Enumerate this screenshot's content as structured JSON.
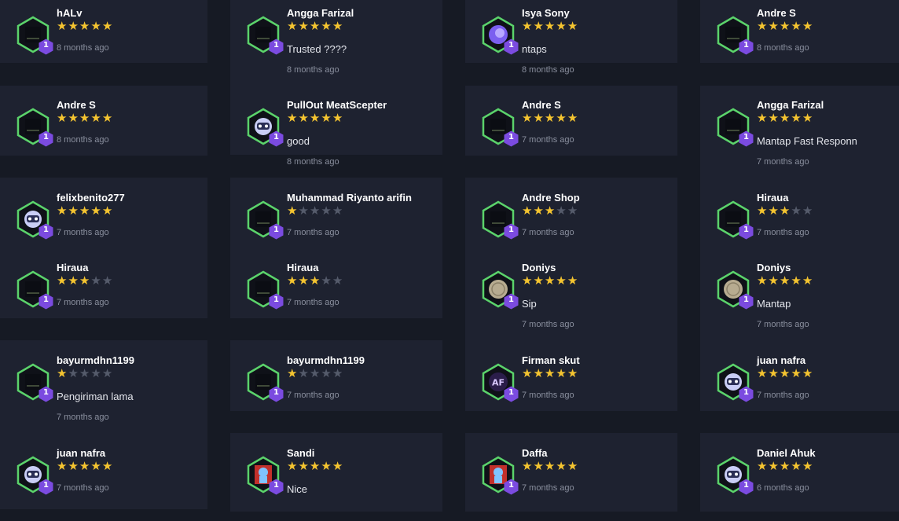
{
  "colors": {
    "background": "#161a24",
    "card": "#1e2230",
    "star_filled": "#f4c430",
    "star_empty": "#555b6b",
    "hex_border": "#5bd36b",
    "badge": "#7b4be0"
  },
  "columns": [
    {
      "cards": [
        {
          "reviews": [
            {
              "name": "hALv",
              "rating": 5,
              "comment": "",
              "time": "8 months ago",
              "avatar": "dark-avatar",
              "level": "1"
            }
          ]
        },
        {
          "reviews": [
            {
              "name": "Andre S",
              "rating": 5,
              "comment": "",
              "time": "8 months ago",
              "avatar": "dark-avatar",
              "level": "1"
            }
          ]
        },
        {
          "reviews": [
            {
              "name": "felixbenito277",
              "rating": 5,
              "comment": "",
              "time": "7 months ago",
              "avatar": "robot-avatar",
              "level": "1"
            },
            {
              "name": "Hiraua",
              "rating": 3,
              "comment": "",
              "time": "7 months ago",
              "avatar": "dark-avatar",
              "level": "1"
            }
          ]
        },
        {
          "reviews": [
            {
              "name": "bayurmdhn1199",
              "rating": 1,
              "comment": "Pengiriman lama",
              "time": "7 months ago",
              "avatar": "dark-avatar",
              "level": "1"
            },
            {
              "name": "juan nafra",
              "rating": 5,
              "comment": "",
              "time": "7 months ago",
              "avatar": "robot-avatar",
              "level": "1"
            }
          ]
        }
      ]
    },
    {
      "cards": [
        {
          "reviews": [
            {
              "name": "Angga Farizal",
              "rating": 5,
              "comment": "Trusted ????",
              "time": "8 months ago",
              "avatar": "dark-avatar",
              "level": "1"
            },
            {
              "name": "PullOut MeatScepter",
              "rating": 5,
              "comment": "good",
              "time": "8 months ago",
              "avatar": "robot-avatar",
              "level": "1"
            }
          ]
        },
        {
          "reviews": [
            {
              "name": "Muhammad Riyanto arifin",
              "rating": 1,
              "comment": "",
              "time": "7 months ago",
              "avatar": "dark-avatar",
              "level": "1"
            },
            {
              "name": "Hiraua",
              "rating": 3,
              "comment": "",
              "time": "7 months ago",
              "avatar": "dark-avatar",
              "level": "1"
            }
          ]
        },
        {
          "reviews": [
            {
              "name": "bayurmdhn1199",
              "rating": 1,
              "comment": "",
              "time": "7 months ago",
              "avatar": "dark-avatar",
              "level": "1"
            }
          ]
        },
        {
          "reviews": [
            {
              "name": "Sandi",
              "rating": 5,
              "comment": "Nice",
              "time": "",
              "avatar": "blue-figure-avatar",
              "level": "1"
            }
          ]
        }
      ]
    },
    {
      "cards": [
        {
          "reviews": [
            {
              "name": "Isya Sony",
              "rating": 5,
              "comment": "ntaps",
              "time": "8 months ago",
              "avatar": "purple-avatar",
              "level": "1"
            }
          ]
        },
        {
          "reviews": [
            {
              "name": "Andre S",
              "rating": 5,
              "comment": "",
              "time": "7 months ago",
              "avatar": "dark-avatar",
              "level": "1"
            }
          ]
        },
        {
          "reviews": [
            {
              "name": "Andre Shop",
              "rating": 3,
              "comment": "",
              "time": "7 months ago",
              "avatar": "dark-avatar",
              "level": "1"
            },
            {
              "name": "Doniys",
              "rating": 5,
              "comment": "Sip",
              "time": "7 months ago",
              "avatar": "stone-avatar",
              "level": "1"
            },
            {
              "name": "Firman skut",
              "rating": 5,
              "comment": "",
              "time": "7 months ago",
              "avatar": "af-logo-avatar",
              "level": "1"
            }
          ]
        },
        {
          "reviews": [
            {
              "name": "Daffa",
              "rating": 5,
              "comment": "",
              "time": "7 months ago",
              "avatar": "blue-figure-avatar",
              "level": "1"
            }
          ]
        }
      ]
    },
    {
      "cards": [
        {
          "reviews": [
            {
              "name": "Andre S",
              "rating": 5,
              "comment": "",
              "time": "8 months ago",
              "avatar": "dark-avatar",
              "level": "1"
            }
          ]
        },
        {
          "reviews": [
            {
              "name": "Angga Farizal",
              "rating": 5,
              "comment": "Mantap Fast Responn",
              "time": "7 months ago",
              "avatar": "dark-avatar",
              "level": "1"
            },
            {
              "name": "Hiraua",
              "rating": 3,
              "comment": "",
              "time": "7 months ago",
              "avatar": "dark-avatar",
              "level": "1"
            },
            {
              "name": "Doniys",
              "rating": 5,
              "comment": "Mantap",
              "time": "7 months ago",
              "avatar": "stone-avatar",
              "level": "1"
            },
            {
              "name": "juan nafra",
              "rating": 5,
              "comment": "",
              "time": "7 months ago",
              "avatar": "robot-avatar",
              "level": "1"
            }
          ]
        },
        {
          "reviews": [
            {
              "name": "Daniel Ahuk",
              "rating": 5,
              "comment": "",
              "time": "6 months ago",
              "avatar": "robot-avatar",
              "level": "1"
            }
          ]
        }
      ]
    }
  ]
}
